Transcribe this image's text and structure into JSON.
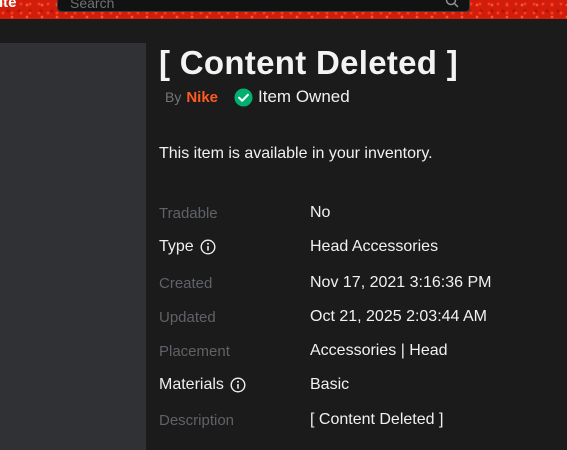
{
  "header": {
    "brand_fragment": "ite",
    "search_placeholder": "Search"
  },
  "item": {
    "title": "[ Content Deleted ]",
    "by_label": "By",
    "creator": "Nike",
    "owned_label": "Item Owned",
    "availability": "This item is available in your inventory."
  },
  "details": [
    {
      "label": "Tradable",
      "value": "No"
    },
    {
      "label": "Type",
      "value": "Head Accessories"
    },
    {
      "label": "Created",
      "value": "Nov 17, 2021 3:16:36 PM"
    },
    {
      "label": "Updated",
      "value": "Oct 21, 2025 2:03:44 AM"
    },
    {
      "label": "Placement",
      "value": "Accessories | Head"
    },
    {
      "label": "Materials",
      "value": "Basic"
    },
    {
      "label": "Description",
      "value": "[ Content Deleted ]"
    }
  ],
  "colors": {
    "header_red": "#d11d0b",
    "creator_orange": "#ff5a1f",
    "owned_green": "#00b06f"
  },
  "icons": {
    "search": "search-icon",
    "owned": "check-circle-icon",
    "info": "info-icon"
  }
}
